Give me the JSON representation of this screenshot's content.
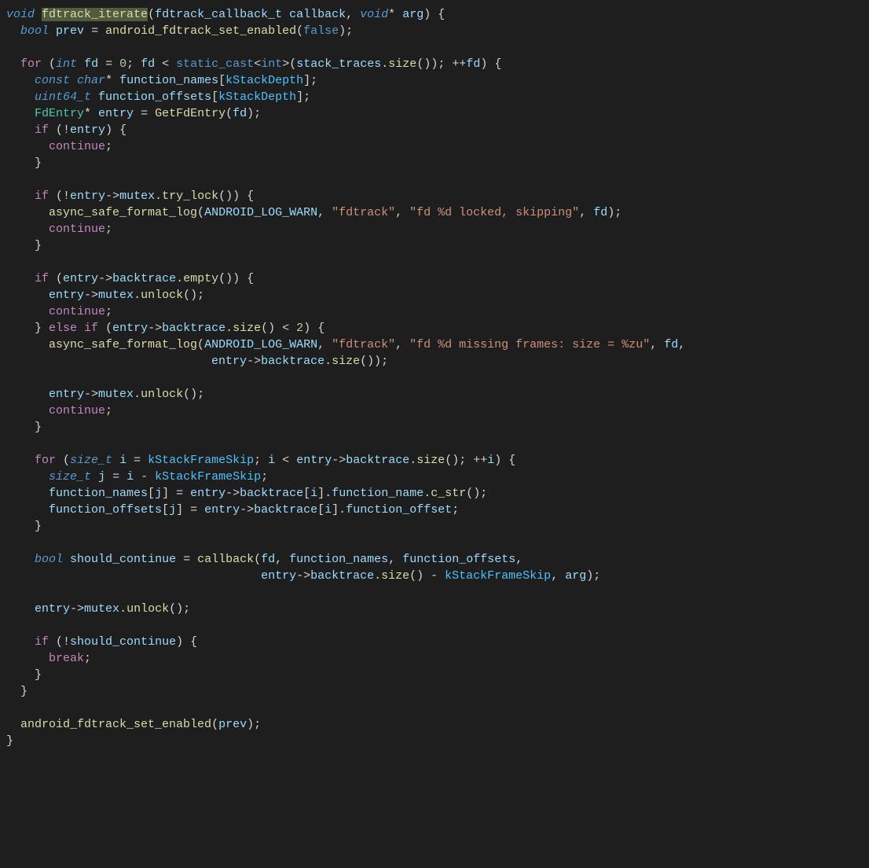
{
  "tokens": [
    [
      [
        "kw2",
        "void"
      ],
      [
        "op",
        " "
      ],
      [
        "fnhl",
        "fdtrack_iterate"
      ],
      [
        "op",
        "("
      ],
      [
        "var",
        "fdtrack_callback_t"
      ],
      [
        "op",
        " "
      ],
      [
        "var",
        "callback"
      ],
      [
        "op",
        ", "
      ],
      [
        "kw2",
        "void"
      ],
      [
        "op",
        "* "
      ],
      [
        "var",
        "arg"
      ],
      [
        "op",
        ") {"
      ]
    ],
    [
      [
        "op",
        "  "
      ],
      [
        "kw2",
        "bool"
      ],
      [
        "op",
        " "
      ],
      [
        "var",
        "prev"
      ],
      [
        "op",
        " = "
      ],
      [
        "fn",
        "android_fdtrack_set_enabled"
      ],
      [
        "op",
        "("
      ],
      [
        "bool",
        "false"
      ],
      [
        "op",
        ");"
      ]
    ],
    [
      [
        "op",
        ""
      ]
    ],
    [
      [
        "op",
        "  "
      ],
      [
        "kw",
        "for"
      ],
      [
        "op",
        " ("
      ],
      [
        "kw2",
        "int"
      ],
      [
        "op",
        " "
      ],
      [
        "var",
        "fd"
      ],
      [
        "op",
        " = "
      ],
      [
        "num",
        "0"
      ],
      [
        "op",
        "; "
      ],
      [
        "var",
        "fd"
      ],
      [
        "op",
        " < "
      ],
      [
        "kw3",
        "static_cast"
      ],
      [
        "op",
        "<"
      ],
      [
        "kw3",
        "int"
      ],
      [
        "op",
        ">("
      ],
      [
        "var",
        "stack_traces"
      ],
      [
        "op",
        "."
      ],
      [
        "fn",
        "size"
      ],
      [
        "op",
        "()); ++"
      ],
      [
        "var",
        "fd"
      ],
      [
        "op",
        ") {"
      ]
    ],
    [
      [
        "op",
        "    "
      ],
      [
        "kw2",
        "const"
      ],
      [
        "op",
        " "
      ],
      [
        "kw2",
        "char"
      ],
      [
        "op",
        "* "
      ],
      [
        "var",
        "function_names"
      ],
      [
        "op",
        "["
      ],
      [
        "cst",
        "kStackDepth"
      ],
      [
        "op",
        "];"
      ]
    ],
    [
      [
        "op",
        "    "
      ],
      [
        "kw2",
        "uint64_t"
      ],
      [
        "op",
        " "
      ],
      [
        "var",
        "function_offsets"
      ],
      [
        "op",
        "["
      ],
      [
        "cst",
        "kStackDepth"
      ],
      [
        "op",
        "];"
      ]
    ],
    [
      [
        "op",
        "    "
      ],
      [
        "type",
        "FdEntry"
      ],
      [
        "op",
        "* "
      ],
      [
        "var",
        "entry"
      ],
      [
        "op",
        " = "
      ],
      [
        "fn",
        "GetFdEntry"
      ],
      [
        "op",
        "("
      ],
      [
        "var",
        "fd"
      ],
      [
        "op",
        ");"
      ]
    ],
    [
      [
        "op",
        "    "
      ],
      [
        "kw",
        "if"
      ],
      [
        "op",
        " (!"
      ],
      [
        "var",
        "entry"
      ],
      [
        "op",
        ") {"
      ]
    ],
    [
      [
        "op",
        "      "
      ],
      [
        "kw",
        "continue"
      ],
      [
        "op",
        ";"
      ]
    ],
    [
      [
        "op",
        "    }"
      ]
    ],
    [
      [
        "op",
        ""
      ]
    ],
    [
      [
        "op",
        "    "
      ],
      [
        "kw",
        "if"
      ],
      [
        "op",
        " (!"
      ],
      [
        "var",
        "entry"
      ],
      [
        "op",
        "->"
      ],
      [
        "field",
        "mutex"
      ],
      [
        "op",
        "."
      ],
      [
        "fn",
        "try_lock"
      ],
      [
        "op",
        "()) {"
      ]
    ],
    [
      [
        "op",
        "      "
      ],
      [
        "fn",
        "async_safe_format_log"
      ],
      [
        "op",
        "("
      ],
      [
        "var",
        "ANDROID_LOG_WARN"
      ],
      [
        "op",
        ", "
      ],
      [
        "str",
        "\"fdtrack\""
      ],
      [
        "op",
        ", "
      ],
      [
        "str",
        "\"fd %d locked, skipping\""
      ],
      [
        "op",
        ", "
      ],
      [
        "var",
        "fd"
      ],
      [
        "op",
        ");"
      ]
    ],
    [
      [
        "op",
        "      "
      ],
      [
        "kw",
        "continue"
      ],
      [
        "op",
        ";"
      ]
    ],
    [
      [
        "op",
        "    }"
      ]
    ],
    [
      [
        "op",
        ""
      ]
    ],
    [
      [
        "op",
        "    "
      ],
      [
        "kw",
        "if"
      ],
      [
        "op",
        " ("
      ],
      [
        "var",
        "entry"
      ],
      [
        "op",
        "->"
      ],
      [
        "field",
        "backtrace"
      ],
      [
        "op",
        "."
      ],
      [
        "fn",
        "empty"
      ],
      [
        "op",
        "()) {"
      ]
    ],
    [
      [
        "op",
        "      "
      ],
      [
        "var",
        "entry"
      ],
      [
        "op",
        "->"
      ],
      [
        "field",
        "mutex"
      ],
      [
        "op",
        "."
      ],
      [
        "fn",
        "unlock"
      ],
      [
        "op",
        "();"
      ]
    ],
    [
      [
        "op",
        "      "
      ],
      [
        "kw",
        "continue"
      ],
      [
        "op",
        ";"
      ]
    ],
    [
      [
        "op",
        "    } "
      ],
      [
        "kw",
        "else"
      ],
      [
        "op",
        " "
      ],
      [
        "kw",
        "if"
      ],
      [
        "op",
        " ("
      ],
      [
        "var",
        "entry"
      ],
      [
        "op",
        "->"
      ],
      [
        "field",
        "backtrace"
      ],
      [
        "op",
        "."
      ],
      [
        "fn",
        "size"
      ],
      [
        "op",
        "() < "
      ],
      [
        "num",
        "2"
      ],
      [
        "op",
        ") {"
      ]
    ],
    [
      [
        "op",
        "      "
      ],
      [
        "fn",
        "async_safe_format_log"
      ],
      [
        "op",
        "("
      ],
      [
        "var",
        "ANDROID_LOG_WARN"
      ],
      [
        "op",
        ", "
      ],
      [
        "str",
        "\"fdtrack\""
      ],
      [
        "op",
        ", "
      ],
      [
        "str",
        "\"fd %d missing frames: size = %zu\""
      ],
      [
        "op",
        ", "
      ],
      [
        "var",
        "fd"
      ],
      [
        "op",
        ","
      ]
    ],
    [
      [
        "op",
        "                             "
      ],
      [
        "var",
        "entry"
      ],
      [
        "op",
        "->"
      ],
      [
        "field",
        "backtrace"
      ],
      [
        "op",
        "."
      ],
      [
        "fn",
        "size"
      ],
      [
        "op",
        "());"
      ]
    ],
    [
      [
        "op",
        ""
      ]
    ],
    [
      [
        "op",
        "      "
      ],
      [
        "var",
        "entry"
      ],
      [
        "op",
        "->"
      ],
      [
        "field",
        "mutex"
      ],
      [
        "op",
        "."
      ],
      [
        "fn",
        "unlock"
      ],
      [
        "op",
        "();"
      ]
    ],
    [
      [
        "op",
        "      "
      ],
      [
        "kw",
        "continue"
      ],
      [
        "op",
        ";"
      ]
    ],
    [
      [
        "op",
        "    }"
      ]
    ],
    [
      [
        "op",
        ""
      ]
    ],
    [
      [
        "op",
        "    "
      ],
      [
        "kw",
        "for"
      ],
      [
        "op",
        " ("
      ],
      [
        "kw2",
        "size_t"
      ],
      [
        "op",
        " "
      ],
      [
        "var",
        "i"
      ],
      [
        "op",
        " = "
      ],
      [
        "cst",
        "kStackFrameSkip"
      ],
      [
        "op",
        "; "
      ],
      [
        "var",
        "i"
      ],
      [
        "op",
        " < "
      ],
      [
        "var",
        "entry"
      ],
      [
        "op",
        "->"
      ],
      [
        "field",
        "backtrace"
      ],
      [
        "op",
        "."
      ],
      [
        "fn",
        "size"
      ],
      [
        "op",
        "(); ++"
      ],
      [
        "var",
        "i"
      ],
      [
        "op",
        ") {"
      ]
    ],
    [
      [
        "op",
        "      "
      ],
      [
        "kw2",
        "size_t"
      ],
      [
        "op",
        " "
      ],
      [
        "var",
        "j"
      ],
      [
        "op",
        " = "
      ],
      [
        "var",
        "i"
      ],
      [
        "op",
        " - "
      ],
      [
        "cst",
        "kStackFrameSkip"
      ],
      [
        "op",
        ";"
      ]
    ],
    [
      [
        "op",
        "      "
      ],
      [
        "var",
        "function_names"
      ],
      [
        "op",
        "["
      ],
      [
        "var",
        "j"
      ],
      [
        "op",
        "] = "
      ],
      [
        "var",
        "entry"
      ],
      [
        "op",
        "->"
      ],
      [
        "field",
        "backtrace"
      ],
      [
        "op",
        "["
      ],
      [
        "var",
        "i"
      ],
      [
        "op",
        "]."
      ],
      [
        "field",
        "function_name"
      ],
      [
        "op",
        "."
      ],
      [
        "fn",
        "c_str"
      ],
      [
        "op",
        "();"
      ]
    ],
    [
      [
        "op",
        "      "
      ],
      [
        "var",
        "function_offsets"
      ],
      [
        "op",
        "["
      ],
      [
        "var",
        "j"
      ],
      [
        "op",
        "] = "
      ],
      [
        "var",
        "entry"
      ],
      [
        "op",
        "->"
      ],
      [
        "field",
        "backtrace"
      ],
      [
        "op",
        "["
      ],
      [
        "var",
        "i"
      ],
      [
        "op",
        "]."
      ],
      [
        "field",
        "function_offset"
      ],
      [
        "op",
        ";"
      ]
    ],
    [
      [
        "op",
        "    }"
      ]
    ],
    [
      [
        "op",
        ""
      ]
    ],
    [
      [
        "op",
        "    "
      ],
      [
        "kw2",
        "bool"
      ],
      [
        "op",
        " "
      ],
      [
        "var",
        "should_continue"
      ],
      [
        "op",
        " = "
      ],
      [
        "fn",
        "callback"
      ],
      [
        "op",
        "("
      ],
      [
        "var",
        "fd"
      ],
      [
        "op",
        ", "
      ],
      [
        "var",
        "function_names"
      ],
      [
        "op",
        ", "
      ],
      [
        "var",
        "function_offsets"
      ],
      [
        "op",
        ","
      ]
    ],
    [
      [
        "op",
        "                                    "
      ],
      [
        "var",
        "entry"
      ],
      [
        "op",
        "->"
      ],
      [
        "field",
        "backtrace"
      ],
      [
        "op",
        "."
      ],
      [
        "fn",
        "size"
      ],
      [
        "op",
        "() - "
      ],
      [
        "cst",
        "kStackFrameSkip"
      ],
      [
        "op",
        ", "
      ],
      [
        "var",
        "arg"
      ],
      [
        "op",
        ");"
      ]
    ],
    [
      [
        "op",
        ""
      ]
    ],
    [
      [
        "op",
        "    "
      ],
      [
        "var",
        "entry"
      ],
      [
        "op",
        "->"
      ],
      [
        "field",
        "mutex"
      ],
      [
        "op",
        "."
      ],
      [
        "fn",
        "unlock"
      ],
      [
        "op",
        "();"
      ]
    ],
    [
      [
        "op",
        ""
      ]
    ],
    [
      [
        "op",
        "    "
      ],
      [
        "kw",
        "if"
      ],
      [
        "op",
        " (!"
      ],
      [
        "var",
        "should_continue"
      ],
      [
        "op",
        ") {"
      ]
    ],
    [
      [
        "op",
        "      "
      ],
      [
        "kw",
        "break"
      ],
      [
        "op",
        ";"
      ]
    ],
    [
      [
        "op",
        "    }"
      ]
    ],
    [
      [
        "op",
        "  }"
      ]
    ],
    [
      [
        "op",
        ""
      ]
    ],
    [
      [
        "op",
        "  "
      ],
      [
        "fn",
        "android_fdtrack_set_enabled"
      ],
      [
        "op",
        "("
      ],
      [
        "var",
        "prev"
      ],
      [
        "op",
        ");"
      ]
    ],
    [
      [
        "op",
        "}"
      ]
    ]
  ]
}
